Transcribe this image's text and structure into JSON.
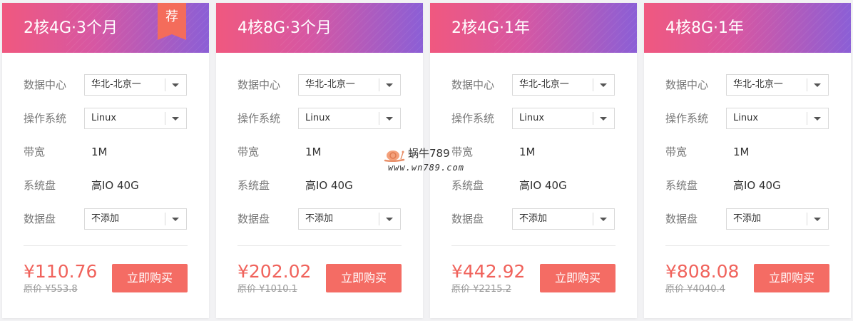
{
  "recommend_badge": "荐",
  "labels": {
    "datacenter": "数据中心",
    "os": "操作系统",
    "bandwidth": "带宽",
    "system_disk": "系统盘",
    "data_disk": "数据盘"
  },
  "buy_label": "立即购买",
  "plans": [
    {
      "title": "2核4G·3个月",
      "datacenter": "华北-北京一",
      "os": "Linux",
      "bandwidth": "1M",
      "system_disk": "高IO 40G",
      "data_disk": "不添加",
      "price": "¥110.76",
      "original_price": "原价 ¥553.8"
    },
    {
      "title": "4核8G·3个月",
      "datacenter": "华北-北京一",
      "os": "Linux",
      "bandwidth": "1M",
      "system_disk": "高IO 40G",
      "data_disk": "不添加",
      "price": "¥202.02",
      "original_price": "原价 ¥1010.1"
    },
    {
      "title": "2核4G·1年",
      "datacenter": "华北-北京一",
      "os": "Linux",
      "bandwidth": "1M",
      "system_disk": "高IO 40G",
      "data_disk": "不添加",
      "price": "¥442.92",
      "original_price": "原价 ¥2215.2"
    },
    {
      "title": "4核8G·1年",
      "datacenter": "华北-北京一",
      "os": "Linux",
      "bandwidth": "1M",
      "system_disk": "高IO 40G",
      "data_disk": "不添加",
      "price": "¥808.08",
      "original_price": "原价 ¥4040.4"
    }
  ],
  "watermark": {
    "name": "蜗牛789",
    "url": "www.wn789.com"
  },
  "colors": {
    "header_start": "#f0587f",
    "header_end": "#8b5fd6",
    "accent": "#f46c64",
    "price": "#f0625b"
  }
}
